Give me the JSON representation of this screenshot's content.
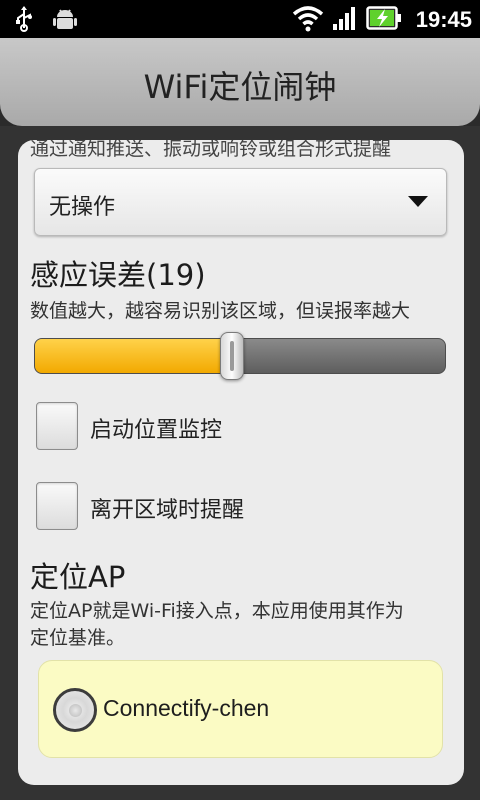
{
  "status_bar": {
    "time": "19:45",
    "icons": [
      "usb-icon",
      "android-debug-icon",
      "wifi-icon",
      "signal-icon",
      "battery-charging-icon"
    ]
  },
  "app": {
    "title": "WiFi定位闹钟"
  },
  "notification": {
    "hint_cut": "通过通知推送、振动或响铃或组合形式提醒",
    "spinner_value": "无操作"
  },
  "sensitivity": {
    "title": "感应误差(19)",
    "description": "数值越大，越容易识别该区域，但误报率越大",
    "slider_level_percent": 48
  },
  "checkboxes": [
    {
      "label": "启动位置监控",
      "checked": false
    },
    {
      "label": "离开区域时提醒",
      "checked": false
    }
  ],
  "ap_section": {
    "title": "定位AP",
    "description_line1": "定位AP就是Wi-Fi接入点，本应用使用其作为",
    "description_line2": "定位基准。",
    "ap_name": "Connectify-chen",
    "selected": false
  },
  "colors": {
    "slider_fill": "#f5b400",
    "ap_box_bg": "#fbfbc4"
  }
}
